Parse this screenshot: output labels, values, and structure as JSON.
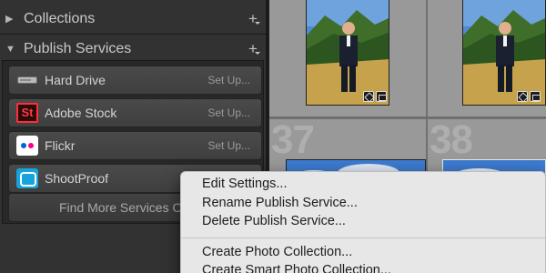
{
  "left_panel": {
    "collections": {
      "title": "Collections",
      "expanded": false,
      "add_symbol": "+"
    },
    "publish_services": {
      "title": "Publish Services",
      "expanded": true,
      "add_symbol": "+",
      "services": [
        {
          "name": "Hard Drive",
          "setup_label": "Set Up...",
          "icon": "hard-drive-icon"
        },
        {
          "name": "Adobe Stock",
          "setup_label": "Set Up...",
          "icon": "adobe-stock-icon",
          "icon_text": "St"
        },
        {
          "name": "Flickr",
          "setup_label": "Set Up...",
          "icon": "flickr-icon"
        },
        {
          "name": "ShootProof",
          "setup_label": "",
          "icon": "shootproof-icon"
        }
      ],
      "find_more_label": "Find More Services On"
    }
  },
  "grid": {
    "cells": [
      {
        "number": "37"
      },
      {
        "number": "38"
      }
    ]
  },
  "context_menu": {
    "items": [
      "Edit Settings...",
      "Rename Publish Service...",
      "Delete Publish Service...",
      "Create Photo Collection...",
      "Create Smart Photo Collection..."
    ]
  },
  "colors": {
    "panel_bg": "#323232",
    "grid_bg": "#8d8d8d",
    "menu_bg": "#e7e7e7",
    "adobe_stock_red": "#ff2e39",
    "flickr_blue": "#0063dc",
    "flickr_pink": "#ff0084",
    "shootproof_blue": "#17a4dc"
  }
}
